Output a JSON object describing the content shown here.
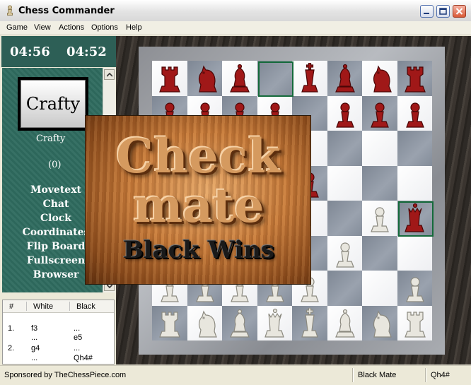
{
  "window": {
    "title": "Chess Commander"
  },
  "menu": [
    "Game",
    "View",
    "Actions",
    "Options",
    "Help"
  ],
  "clocks": {
    "left": "04:56",
    "right": "04:52"
  },
  "player": {
    "card_label": "Crafty",
    "name": "Crafty",
    "rating": "(0)"
  },
  "panel_links": [
    "Movetext",
    "Chat",
    "Clock",
    "Coordinates",
    "Flip Board",
    "Fullscreen",
    "Browser"
  ],
  "move_table": {
    "headers": [
      "#",
      "White",
      "Black"
    ],
    "rows": [
      {
        "num": "1.",
        "white": "f3",
        "black": "..."
      },
      {
        "num": "",
        "white": "...",
        "black": "e5"
      },
      {
        "num": "2.",
        "white": "g4",
        "black": "..."
      },
      {
        "num": "",
        "white": "...",
        "black": "Qh4#"
      }
    ]
  },
  "overlay": {
    "line1": "Check",
    "line2": "mate",
    "line3": "Black Wins"
  },
  "status": {
    "sponsor": "Sponsored by TheChessPiece.com",
    "result": "Black Mate",
    "last_move": "Qh4#"
  },
  "board": {
    "colors": {
      "black_piece": "#a01818",
      "white_piece": "#e8e6de"
    },
    "highlights": [
      "d8",
      "h4"
    ],
    "pieces": [
      {
        "sq": "a8",
        "t": "rook",
        "c": "b"
      },
      {
        "sq": "b8",
        "t": "knight",
        "c": "b"
      },
      {
        "sq": "c8",
        "t": "bishop",
        "c": "b"
      },
      {
        "sq": "e8",
        "t": "king",
        "c": "b"
      },
      {
        "sq": "f8",
        "t": "bishop",
        "c": "b"
      },
      {
        "sq": "g8",
        "t": "knight",
        "c": "b"
      },
      {
        "sq": "h8",
        "t": "rook",
        "c": "b"
      },
      {
        "sq": "a7",
        "t": "pawn",
        "c": "b"
      },
      {
        "sq": "b7",
        "t": "pawn",
        "c": "b"
      },
      {
        "sq": "c7",
        "t": "pawn",
        "c": "b"
      },
      {
        "sq": "d7",
        "t": "pawn",
        "c": "b"
      },
      {
        "sq": "f7",
        "t": "pawn",
        "c": "b"
      },
      {
        "sq": "g7",
        "t": "pawn",
        "c": "b"
      },
      {
        "sq": "h7",
        "t": "pawn",
        "c": "b"
      },
      {
        "sq": "e5",
        "t": "pawn",
        "c": "b"
      },
      {
        "sq": "h4",
        "t": "queen",
        "c": "b"
      },
      {
        "sq": "g4",
        "t": "pawn",
        "c": "w"
      },
      {
        "sq": "f3",
        "t": "pawn",
        "c": "w"
      },
      {
        "sq": "a2",
        "t": "pawn",
        "c": "w"
      },
      {
        "sq": "b2",
        "t": "pawn",
        "c": "w"
      },
      {
        "sq": "c2",
        "t": "pawn",
        "c": "w"
      },
      {
        "sq": "d2",
        "t": "pawn",
        "c": "w"
      },
      {
        "sq": "e2",
        "t": "pawn",
        "c": "w"
      },
      {
        "sq": "h2",
        "t": "pawn",
        "c": "w"
      },
      {
        "sq": "a1",
        "t": "rook",
        "c": "w"
      },
      {
        "sq": "b1",
        "t": "knight",
        "c": "w"
      },
      {
        "sq": "c1",
        "t": "bishop",
        "c": "w"
      },
      {
        "sq": "d1",
        "t": "queen",
        "c": "w"
      },
      {
        "sq": "e1",
        "t": "king",
        "c": "w"
      },
      {
        "sq": "f1",
        "t": "bishop",
        "c": "w"
      },
      {
        "sq": "g1",
        "t": "knight",
        "c": "w"
      },
      {
        "sq": "h1",
        "t": "rook",
        "c": "w"
      }
    ]
  }
}
